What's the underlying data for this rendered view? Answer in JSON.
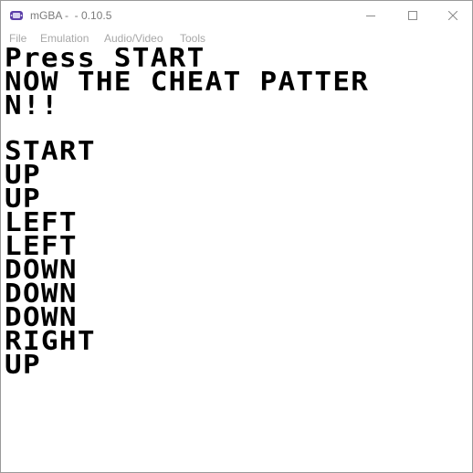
{
  "window": {
    "title": "mGBA -  - 0.10.5",
    "accent": "#5b3fa8"
  },
  "titlebar_buttons": {
    "minimize_icon": "minimize-icon",
    "maximize_icon": "maximize-icon",
    "close_icon": "close-icon"
  },
  "menu": {
    "items": [
      "File",
      "Emulation",
      "Audio/Video",
      "Tools"
    ]
  },
  "game_screen": {
    "lines": [
      "Press START",
      "NOW THE CHEAT PATTER",
      "N!!",
      "",
      "START",
      "UP",
      "UP",
      "LEFT",
      "LEFT",
      "DOWN",
      "DOWN",
      "DOWN",
      "RIGHT",
      "UP"
    ],
    "text_color": "#000000",
    "background_color": "#ffffff"
  }
}
